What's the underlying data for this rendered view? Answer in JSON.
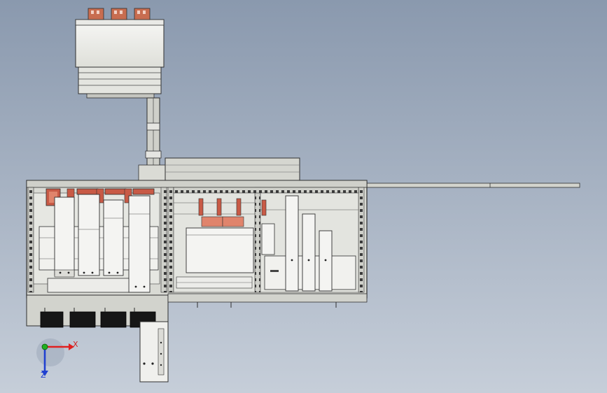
{
  "viewport": {
    "background_top": "#8a99ae",
    "background_bottom": "#c6ced9"
  },
  "colors": {
    "steel": "#d7d8d2",
    "steel_dark": "#a9aaa4",
    "outline": "#2f2f2f",
    "white_part": "#f4f4f2",
    "copper": "#c85a46",
    "copper_light": "#e0846c",
    "black_part": "#161616",
    "axis_x": "#e02020",
    "axis_y": "#20b020",
    "axis_z": "#2040d0"
  },
  "triad": {
    "x_label": "X",
    "z_label": "Z"
  }
}
